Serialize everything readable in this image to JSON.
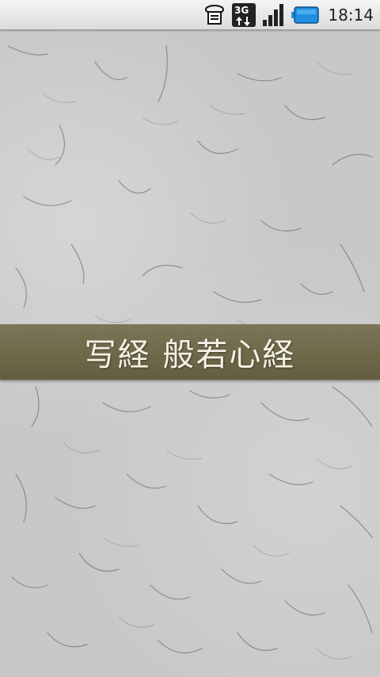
{
  "status_bar": {
    "time": "18:14",
    "network_label": "3G",
    "icons": [
      "notification-icon",
      "network-3g-icon",
      "signal-strength-icon",
      "battery-icon"
    ]
  },
  "banner": {
    "title": "写経 般若心経"
  },
  "colors": {
    "banner": "#6f6849",
    "paper": "#c8c8c8",
    "battery": "#1f8fe0",
    "banner_text": "#f4f1e6"
  }
}
